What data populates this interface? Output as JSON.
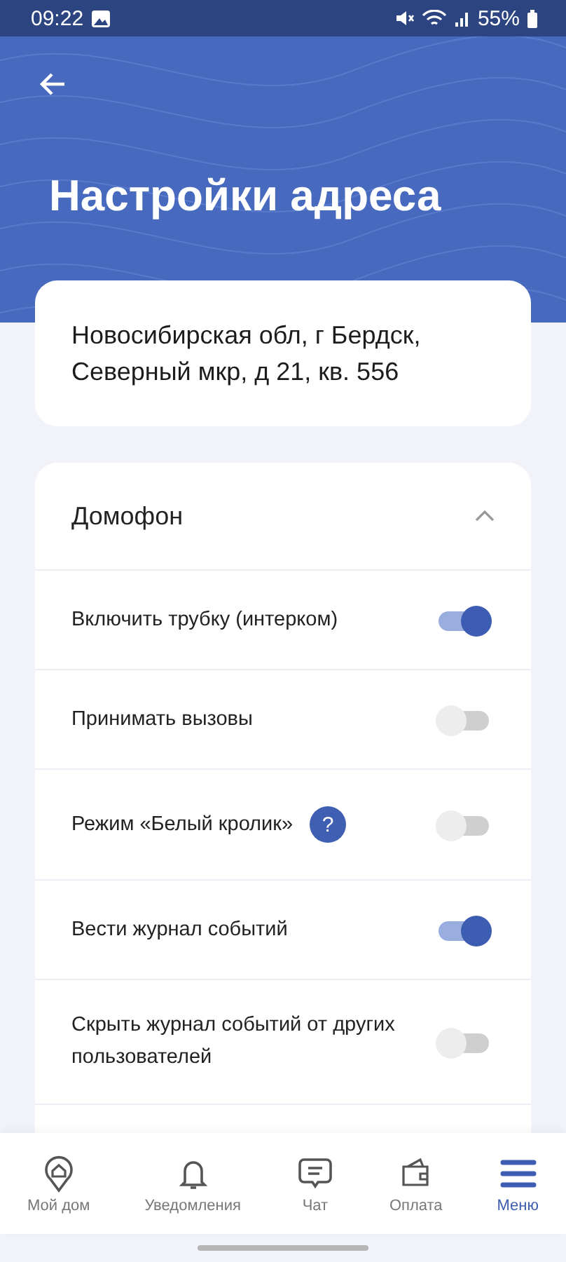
{
  "status_bar": {
    "time": "09:22",
    "battery": "55%"
  },
  "header": {
    "title": "Настройки адреса"
  },
  "address": {
    "lines": [
      "Новосибирская обл, г Бердск,",
      "Северный мкр, д 21, кв. 556"
    ]
  },
  "section": {
    "title": "Домофон",
    "expanded": true,
    "items": [
      {
        "label": "Включить трубку (интерком)",
        "on": true
      },
      {
        "label": "Принимать вызовы",
        "on": false
      },
      {
        "label": "Режим «Белый кролик»",
        "on": false,
        "help": "?"
      },
      {
        "label": "Вести журнал событий",
        "on": true
      },
      {
        "label": "Скрыть журнал событий от других пользователей",
        "on": false
      }
    ]
  },
  "nav": [
    {
      "label": "Мой дом",
      "selected": false
    },
    {
      "label": "Уведомления",
      "selected": false
    },
    {
      "label": "Чат",
      "selected": false
    },
    {
      "label": "Оплата",
      "selected": false
    },
    {
      "label": "Меню",
      "selected": true
    }
  ]
}
